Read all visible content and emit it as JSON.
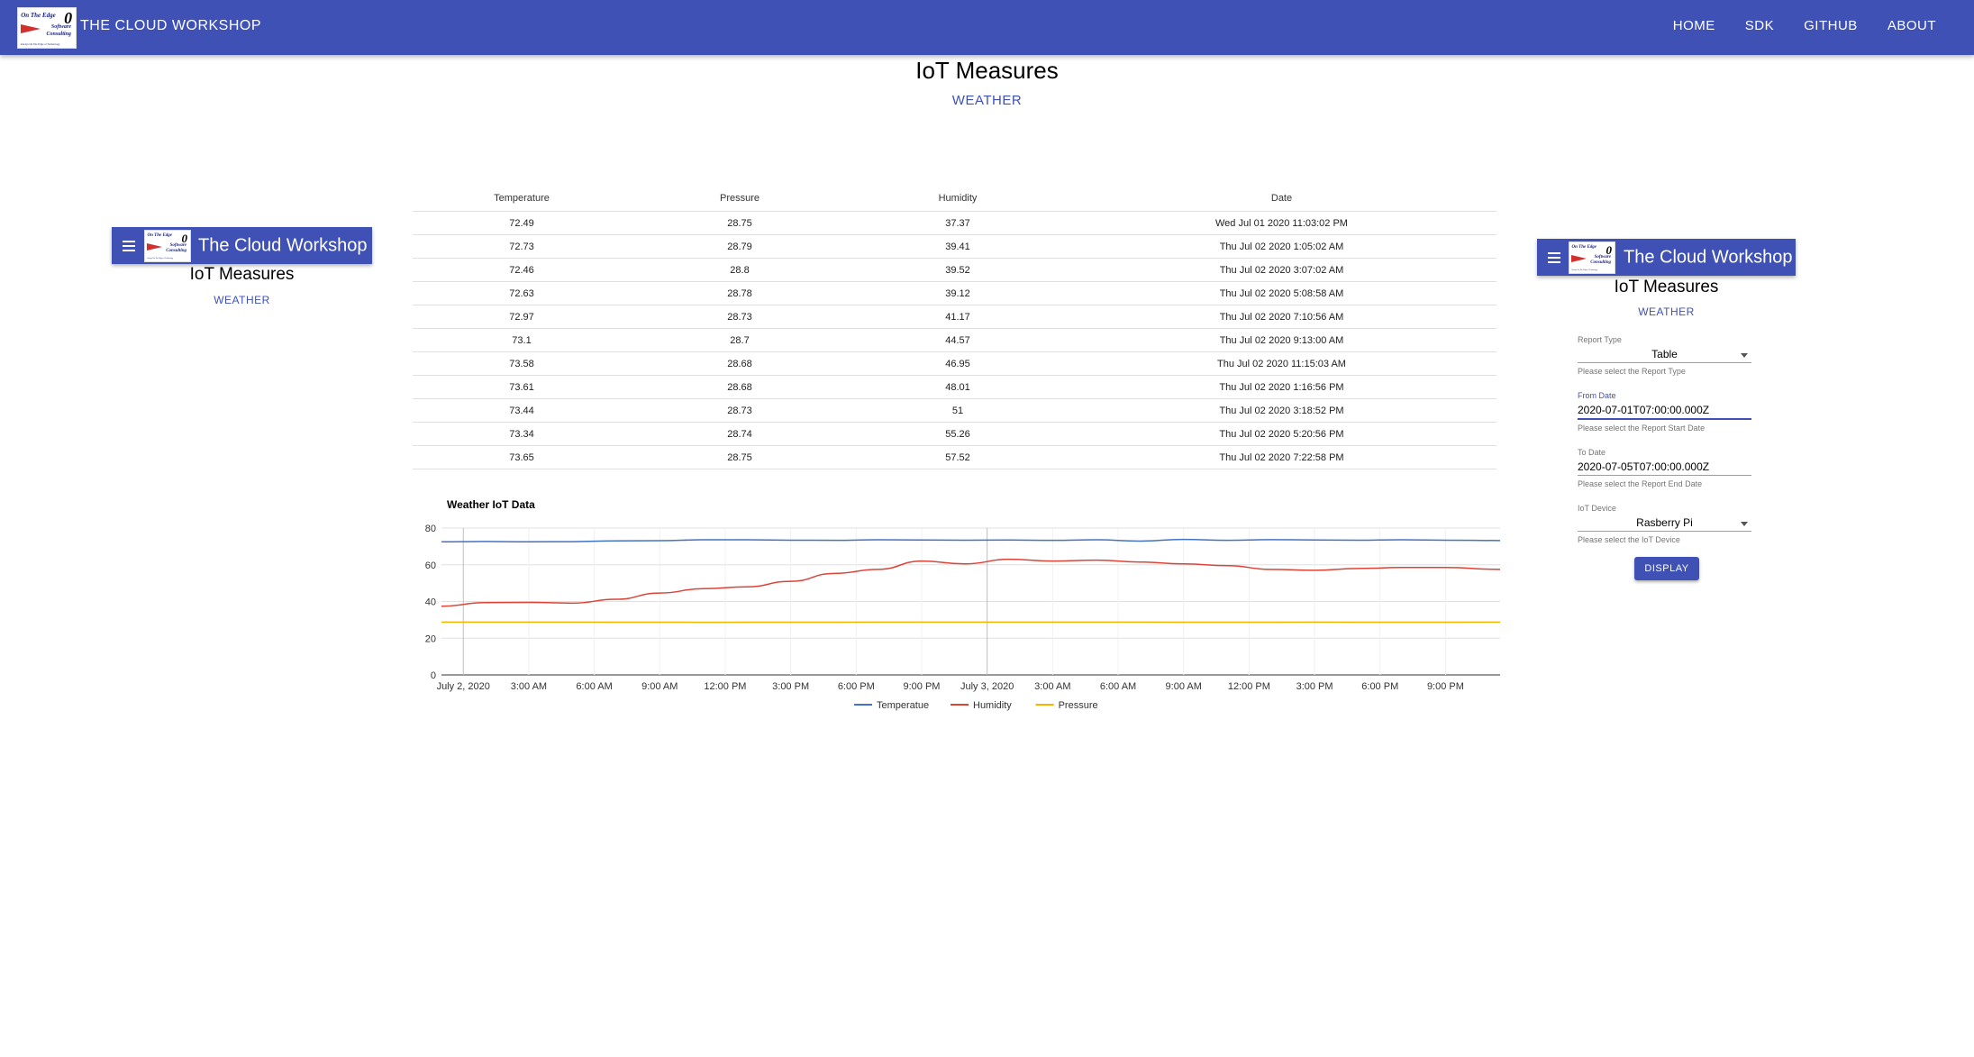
{
  "appbar": {
    "logo": {
      "line1": "On The Edge",
      "badge": "0",
      "line2": "Software",
      "line3": "Consulting",
      "fine": "Always On The Edge of Technology"
    },
    "title": "THE CLOUD WORKSHOP",
    "nav": [
      "HOME",
      "SDK",
      "GITHUB",
      "ABOUT"
    ],
    "color": "#3f51b5"
  },
  "page": {
    "title": "IoT Measures",
    "subtitle": "WEATHER"
  },
  "left_panel": {
    "bar_title": "The Cloud Workshop",
    "title": "IoT Measures",
    "subtitle": "WEATHER"
  },
  "right_panel": {
    "bar_title": "The Cloud Workshop",
    "title": "IoT Measures",
    "subtitle": "WEATHER",
    "form": {
      "report_type": {
        "label": "Report Type",
        "value": "Table",
        "help": "Please select the Report Type"
      },
      "from_date": {
        "label": "From Date",
        "value": "2020-07-01T07:00:00.000Z",
        "help": "Please select the Report Start Date"
      },
      "to_date": {
        "label": "To Date",
        "value": "2020-07-05T07:00:00.000Z",
        "help": "Please select the Report End Date"
      },
      "iot_device": {
        "label": "IoT Device",
        "value": "Rasberry Pi",
        "help": "Please select the IoT Device"
      },
      "display_label": "DISPLAY"
    }
  },
  "table": {
    "headers": [
      "Temperature",
      "Pressure",
      "Humidity",
      "Date"
    ],
    "rows": [
      [
        "72.49",
        "28.75",
        "37.37",
        "Wed Jul 01 2020 11:03:02 PM"
      ],
      [
        "72.73",
        "28.79",
        "39.41",
        "Thu Jul 02 2020 1:05:02 AM"
      ],
      [
        "72.46",
        "28.8",
        "39.52",
        "Thu Jul 02 2020 3:07:02 AM"
      ],
      [
        "72.63",
        "28.78",
        "39.12",
        "Thu Jul 02 2020 5:08:58 AM"
      ],
      [
        "72.97",
        "28.73",
        "41.17",
        "Thu Jul 02 2020 7:10:56 AM"
      ],
      [
        "73.1",
        "28.7",
        "44.57",
        "Thu Jul 02 2020 9:13:00 AM"
      ],
      [
        "73.58",
        "28.68",
        "46.95",
        "Thu Jul 02 2020 11:15:03 AM"
      ],
      [
        "73.61",
        "28.68",
        "48.01",
        "Thu Jul 02 2020 1:16:56 PM"
      ],
      [
        "73.44",
        "28.73",
        "51",
        "Thu Jul 02 2020 3:18:52 PM"
      ],
      [
        "73.34",
        "28.74",
        "55.26",
        "Thu Jul 02 2020 5:20:56 PM"
      ],
      [
        "73.65",
        "28.75",
        "57.52",
        "Thu Jul 02 2020 7:22:58 PM"
      ]
    ]
  },
  "chart_data": {
    "type": "line",
    "title": "Weather IoT Data",
    "ylim": [
      0,
      80
    ],
    "yticks": [
      0,
      20,
      40,
      60,
      80
    ],
    "xticks": [
      "July 2, 2020",
      "3:00 AM",
      "6:00 AM",
      "9:00 AM",
      "12:00 PM",
      "3:00 PM",
      "6:00 PM",
      "9:00 PM",
      "July 3, 2020",
      "3:00 AM",
      "6:00 AM",
      "9:00 AM",
      "12:00 PM",
      "3:00 PM",
      "6:00 PM",
      "9:00 PM"
    ],
    "xtick_hours": [
      0,
      3,
      6,
      9,
      12,
      15,
      18,
      21,
      24,
      27,
      30,
      33,
      36,
      39,
      42,
      45
    ],
    "xlim_hours": [
      -1,
      47.5
    ],
    "legend_position": "bottom",
    "series": [
      {
        "name": "Temperatue",
        "color": "#4472c4",
        "x": [
          -1,
          1,
          3,
          5,
          7,
          9,
          11,
          13,
          15,
          17,
          19,
          21,
          23,
          25,
          27,
          29,
          31,
          33,
          35,
          37,
          39,
          41,
          43,
          45,
          47.5
        ],
        "y": [
          72.5,
          72.7,
          72.5,
          72.6,
          73.0,
          73.1,
          73.6,
          73.6,
          73.4,
          73.3,
          73.6,
          73.5,
          73.4,
          73.5,
          73.3,
          73.6,
          72.9,
          73.8,
          73.3,
          73.7,
          73.5,
          73.4,
          73.6,
          73.4,
          73.2
        ]
      },
      {
        "name": "Humidity",
        "color": "#db4437",
        "x": [
          -1,
          1,
          3,
          5,
          7,
          9,
          11,
          13,
          15,
          17,
          19,
          21,
          23,
          25,
          27,
          29,
          31,
          33,
          35,
          37,
          39,
          41,
          43,
          45,
          47.5
        ],
        "y": [
          37.4,
          39.4,
          39.5,
          39.1,
          41.2,
          44.6,
          47.0,
          48.0,
          51.0,
          55.3,
          57.5,
          62.0,
          60.5,
          63.0,
          62.0,
          62.5,
          61.5,
          60.5,
          59.5,
          57.5,
          57.0,
          58.0,
          58.5,
          58.5,
          57.5
        ]
      },
      {
        "name": "Pressure",
        "color": "#f4b400",
        "x": [
          -1,
          3,
          7,
          11,
          15,
          19,
          23,
          27,
          31,
          35,
          39,
          43,
          47.5
        ],
        "y": [
          28.75,
          28.8,
          28.73,
          28.68,
          28.73,
          28.75,
          28.8,
          28.8,
          28.75,
          28.7,
          28.75,
          28.7,
          28.75
        ]
      }
    ]
  }
}
